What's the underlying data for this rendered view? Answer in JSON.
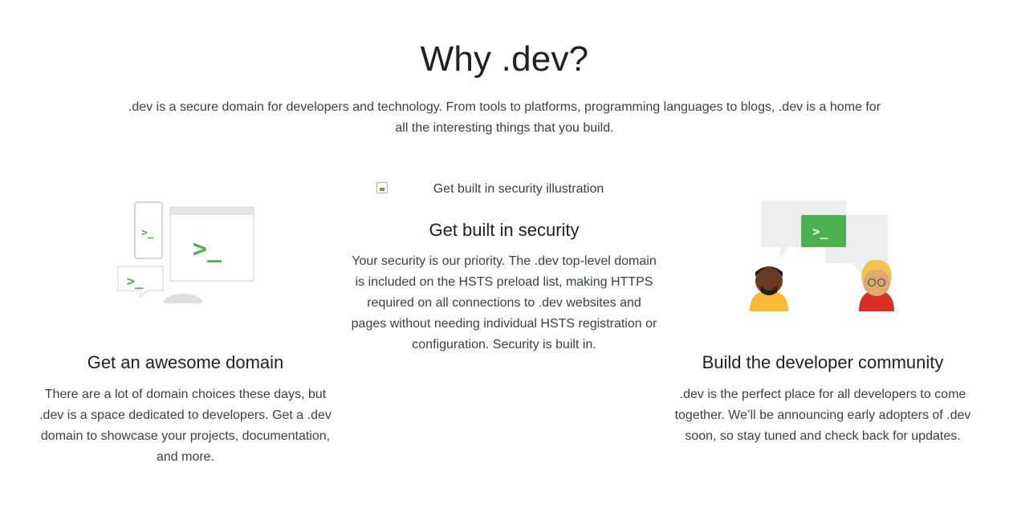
{
  "header": {
    "title": "Why .dev?",
    "intro": ".dev is a secure domain for developers and technology. From tools to platforms, programming languages to blogs, .dev is a home for all the interesting things that you build."
  },
  "features": [
    {
      "title": "Get an awesome domain",
      "body": "There are a lot of domain choices these days, but .dev is a space dedicated to developers. Get a .dev domain to showcase your projects, documentation, and more.",
      "illustration_icon": "devices-terminal-illustration"
    },
    {
      "title": "Get built in security",
      "body": "Your security is our priority. The .dev top-level domain is included on the HSTS preload list, making HTTPS required on all connections to .dev websites and pages without needing individual HSTS registration or configuration. Security is built in.",
      "image_alt": "Get built in security illustration"
    },
    {
      "title": "Build the developer community",
      "body": ".dev is the perfect place for all developers to come together. We’ll be announcing early adopters of .dev soon, so stay tuned and check back for updates.",
      "illustration_icon": "developer-chat-illustration"
    }
  ],
  "illustration_text": {
    "prompt": ">_"
  },
  "colors": {
    "terminal_green": "#4caf50",
    "panel_gray": "#eeeeee",
    "text_primary": "#202124",
    "text_secondary": "#3c4043"
  }
}
